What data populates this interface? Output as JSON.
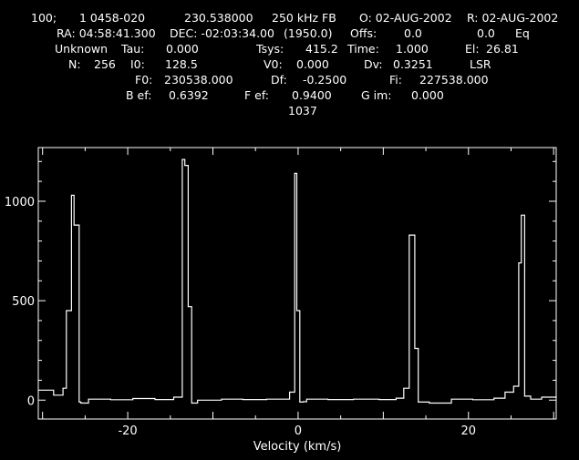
{
  "header": {
    "line1": {
      "scan": "100;",
      "source": "1 0458-020",
      "freq": "230.538000",
      "backend": "250 kHz FB",
      "obs": "O: 02-AUG-2002",
      "red": "R: 02-AUG-2002"
    },
    "line2": {
      "ra": "RA: 04:58:41.300",
      "dec": "DEC: -02:03:34.00",
      "epoch": "(1950.0)",
      "offs_label": "Offs:",
      "offs_x": "0.0",
      "offs_y": "0.0",
      "coord": "Eq"
    },
    "line3": {
      "status": "Unknown",
      "tau_label": "Tau:",
      "tau": "0.000",
      "tsys_label": "Tsys:",
      "tsys": "415.2",
      "time_label": "Time:",
      "time": "1.000",
      "el_label": "El:",
      "el": "26.81"
    },
    "line4": {
      "n_label": "N:",
      "n": "256",
      "i0_label": "I0:",
      "i0": "128.5",
      "v0_label": "V0:",
      "v0": "0.000",
      "dv_label": "Dv:",
      "dv": "0.3251",
      "frame": "LSR"
    },
    "line5": {
      "f0_label": "F0:",
      "f0": "230538.000",
      "df_label": "Df:",
      "df": "-0.2500",
      "fi_label": "Fi:",
      "fi": "227538.000"
    },
    "line6": {
      "beff_label": "B ef:",
      "beff": "0.6392",
      "feff_label": "F ef:",
      "feff": "0.9400",
      "gim_label": "G im:",
      "gim": "0.000"
    },
    "line7": {
      "id": "1037"
    }
  },
  "chart_data": {
    "type": "line",
    "style": "step",
    "xlabel": "Velocity (km/s)",
    "ylabel": "",
    "xlim": [
      -30.5,
      30.3
    ],
    "ylim": [
      -95,
      1270
    ],
    "xticks": [
      -20,
      0,
      20
    ],
    "xtick_labels": [
      "-20",
      "0",
      "20"
    ],
    "yticks": [
      0,
      500,
      1000
    ],
    "ytick_labels": [
      "0",
      "500",
      "1000"
    ],
    "grid": false,
    "series": [
      {
        "color": "#ffffff",
        "x": [
          -30.5,
          -28.7,
          -27.6,
          -27.2,
          -26.6,
          -26.3,
          -25.7,
          -25.5,
          -24.6,
          -22.0,
          -19.4,
          -16.8,
          -14.6,
          -13.6,
          -13.3,
          -12.9,
          -12.5,
          -11.8,
          -9.0,
          -6.5,
          -3.7,
          -1.0,
          -0.4,
          -0.15,
          0.2,
          0.6,
          1.0,
          3.5,
          6.5,
          9.5,
          11.5,
          12.4,
          13.05,
          13.7,
          14.1,
          15.4,
          18.0,
          20.5,
          23.0,
          24.3,
          25.3,
          25.9,
          26.2,
          26.6,
          27.3,
          28.6,
          30.3
        ],
        "y": [
          50,
          25,
          60,
          450,
          1030,
          880,
          -10,
          -15,
          5,
          2,
          8,
          3,
          15,
          1210,
          1180,
          470,
          -15,
          0,
          5,
          3,
          5,
          40,
          1140,
          450,
          -10,
          -8,
          5,
          3,
          5,
          3,
          10,
          60,
          830,
          260,
          -10,
          -15,
          5,
          2,
          10,
          40,
          70,
          690,
          930,
          20,
          5,
          15,
          10
        ]
      }
    ]
  }
}
